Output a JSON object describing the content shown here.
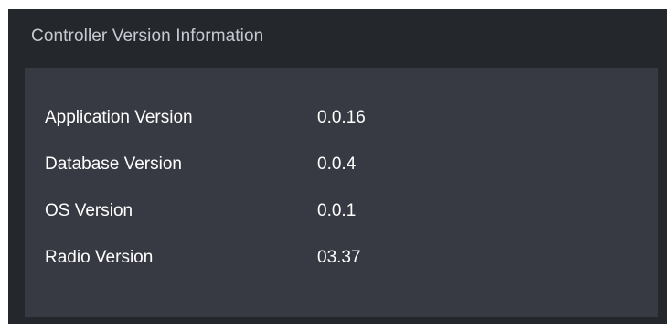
{
  "panel": {
    "title": "Controller Version Information",
    "rows": [
      {
        "label": "Application Version",
        "value": "0.0.16"
      },
      {
        "label": "Database Version",
        "value": "0.0.4"
      },
      {
        "label": "OS Version",
        "value": "0.0.1"
      },
      {
        "label": "Radio Version",
        "value": "03.37"
      }
    ]
  },
  "colors": {
    "panel_bg": "#24272c",
    "body_bg": "#373a43",
    "header_text": "#c5cad1",
    "row_text": "#ffffff"
  }
}
